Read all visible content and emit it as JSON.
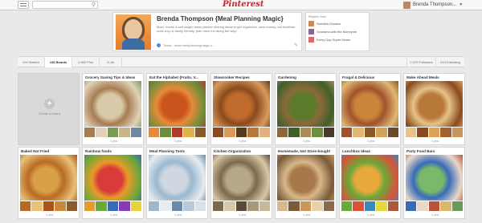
{
  "header": {
    "logo": "Pinterest",
    "user_name": "Brenda Thompson..."
  },
  "profile": {
    "name": "Brenda Thompson {Meal Planning Magic}",
    "bio": "Mom, foodie & self-taught meal planner sharing ideas to get organized, save money, eat healthier, cook-it-up & family friendly, plan have fun along the way!",
    "location": "Texas · www.mealplanningmagic.c...",
    "replies_heading": "Replies from",
    "replies": [
      "Swedish Dreams",
      "Grandma with the Moneyme",
      "Every Day Super Moms"
    ]
  },
  "tabs": [
    {
      "label": "Get Started"
    },
    {
      "label": "135 Boards"
    },
    {
      "label": "2,982 Pins"
    },
    {
      "label": "11 Ak"
    },
    {
      "label": "2,370 Followers"
    },
    {
      "label": "244 Following"
    }
  ],
  "create_board": "Create a board",
  "boards": [
    {
      "title": "Grocery Saving Tips & Ideas",
      "pins": "0 pins",
      "colors": [
        "#d8c9a8",
        "#a67c52",
        "#e0d2b8",
        "#7a9a5a",
        "#c9b58c",
        "#6e8b9e"
      ]
    },
    {
      "title": "Eat the Alphabet {Fruits, V...",
      "pins": "0 pins",
      "colors": [
        "#c9541c",
        "#e58b3a",
        "#6b8e3a",
        "#b03a2e",
        "#e0b24a",
        "#8b5a2b"
      ]
    },
    {
      "title": "Slowcooker Recipes",
      "pins": "0 pins",
      "colors": [
        "#c06a2c",
        "#8a4a1e",
        "#d99a5a",
        "#5a3a1e",
        "#b8783a",
        "#e2b27a"
      ]
    },
    {
      "title": "Gardening",
      "pins": "0 pins",
      "colors": [
        "#5c7a2c",
        "#8a6a3a",
        "#3f5f2a",
        "#a98b5a",
        "#6e8e3e",
        "#4a3a2a"
      ]
    },
    {
      "title": "Frugal & Delicious",
      "pins": "0 pins",
      "colors": [
        "#c9853a",
        "#a0522d",
        "#e0b870",
        "#8b5a2b",
        "#d4a35a",
        "#6a4a2a"
      ]
    },
    {
      "title": "Make Ahead Meals",
      "pins": "0 pins",
      "colors": [
        "#b8783a",
        "#e6c38a",
        "#8a4a1e",
        "#d9a35a",
        "#a0622a",
        "#c9955a"
      ]
    },
    {
      "title": "Baked Not Fried",
      "pins": "0 pins",
      "colors": [
        "#d9a04a",
        "#b86a22",
        "#e8c27a",
        "#a8541c",
        "#c9893a",
        "#8a5a2a"
      ]
    },
    {
      "title": "Rainbow foods",
      "pins": "0 pins",
      "colors": [
        "#d93a3a",
        "#e89a2a",
        "#6aa83a",
        "#3a6ab8",
        "#8a3ab8",
        "#e8d23a"
      ]
    },
    {
      "title": "Meal Planning Tools",
      "pins": "0 pins",
      "colors": [
        "#cfd8e0",
        "#9ab8d0",
        "#e8ecef",
        "#6a8aa8",
        "#b8c8d8",
        "#d8e0e8"
      ]
    },
    {
      "title": "Kitchen Organization",
      "pins": "0 pins",
      "colors": [
        "#b8a88a",
        "#7a6a4a",
        "#d8c8a8",
        "#5a4a3a",
        "#a89878",
        "#c8b898"
      ]
    },
    {
      "title": "Homemade, Not Store-bought",
      "pins": "0 pins",
      "colors": [
        "#a8784a",
        "#d8b88a",
        "#7a5a3a",
        "#c8985a",
        "#e8d0a8",
        "#8a6a4a"
      ]
    },
    {
      "title": "Lunchbox Ideas",
      "pins": "0 pins",
      "colors": [
        "#e8a83a",
        "#6aa83a",
        "#d8533a",
        "#3a8ab8",
        "#e8d83a",
        "#a85a3a"
      ]
    },
    {
      "title": "Party Food Bars",
      "pins": "0 pins",
      "colors": [
        "#7ab86a",
        "#3a6ab8",
        "#e8d8c8",
        "#b8533a",
        "#d8b86a",
        "#6a9a5a"
      ]
    }
  ]
}
